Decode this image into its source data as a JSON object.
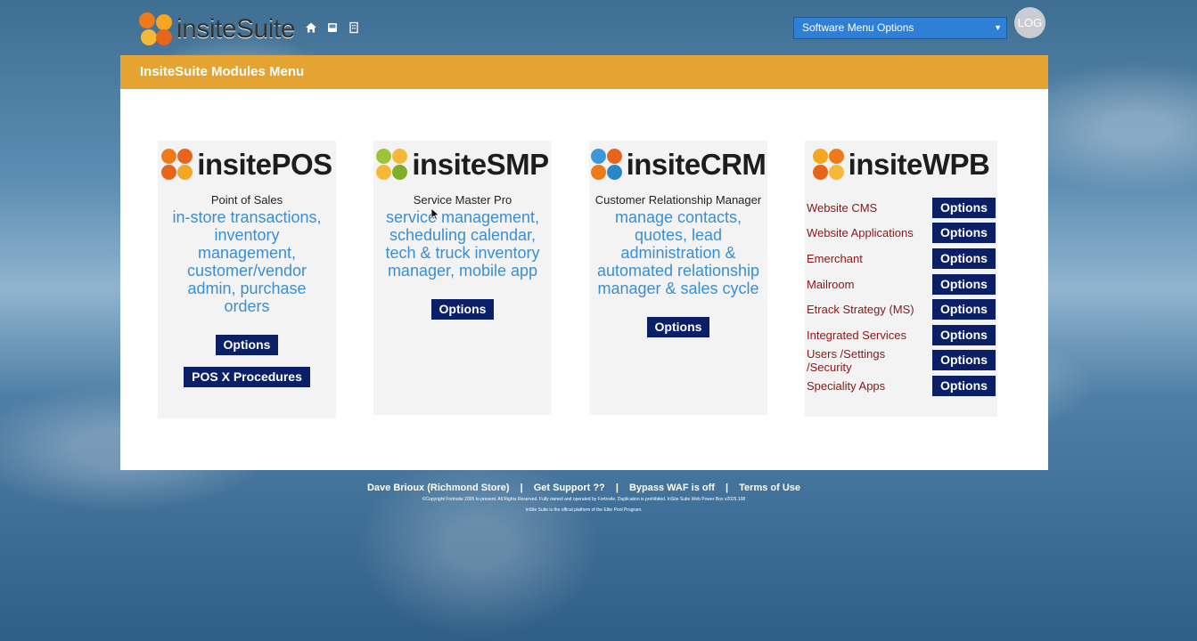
{
  "header": {
    "logo_text": "insiteSuite",
    "nav_icons": [
      "home-icon",
      "inbox-icon",
      "building-icon"
    ],
    "menu_select_value": "Software Menu Options",
    "log_button": "LOG"
  },
  "panel": {
    "title": "InsiteSuite Modules Menu"
  },
  "modules": {
    "pos": {
      "name": "insitePOS",
      "subtitle": "Point of Sales",
      "description": "in-store transactions, inventory management, customer/vendor admin, purchase orders",
      "options_label": "Options",
      "extra_button": "POS X Procedures"
    },
    "smp": {
      "name": "insiteSMP",
      "subtitle": "Service Master Pro",
      "description": "service management, scheduling calendar, tech & truck inventory manager, mobile app",
      "options_label": "Options"
    },
    "crm": {
      "name": "insiteCRM",
      "subtitle": "Customer Relationship Manager",
      "description": "manage contacts, quotes, lead administration & automated relationship manager & sales cycle",
      "options_label": "Options"
    },
    "wpb": {
      "name": "insiteWPB",
      "items": [
        {
          "label": "Website CMS",
          "button": "Options"
        },
        {
          "label": "Website Applications",
          "button": "Options"
        },
        {
          "label": "Emerchant",
          "button": "Options"
        },
        {
          "label": "Mailroom",
          "button": "Options"
        },
        {
          "label": "Etrack Strategy (MS)",
          "button": "Options"
        },
        {
          "label": "Integrated Services",
          "button": "Options"
        },
        {
          "label": "Users /Settings /Security",
          "button": "Options"
        },
        {
          "label": "Speciality Apps",
          "button": "Options"
        }
      ]
    }
  },
  "colors": {
    "header_bar": "#e5a431",
    "button_bg": "#0a1f66",
    "description_text": "#3a8ed4",
    "wpb_label": "#8a1616",
    "select_bg": "#2f7fd6"
  },
  "footer": {
    "user": "Dave Brioux (Richmond Store)",
    "support": "Get Support ??",
    "waf": "Bypass WAF is off",
    "terms": "Terms of Use",
    "copyright_1": "©Copyright Fortnsite 2005 to present. All Rights Reserved. Fully owned and operated by Fortnsite. Duplication is prohibited. InSite Suite Web Power Box v2025.108",
    "copyright_2": "InSite Suite is the offical platform of the Elite Pool Program."
  }
}
